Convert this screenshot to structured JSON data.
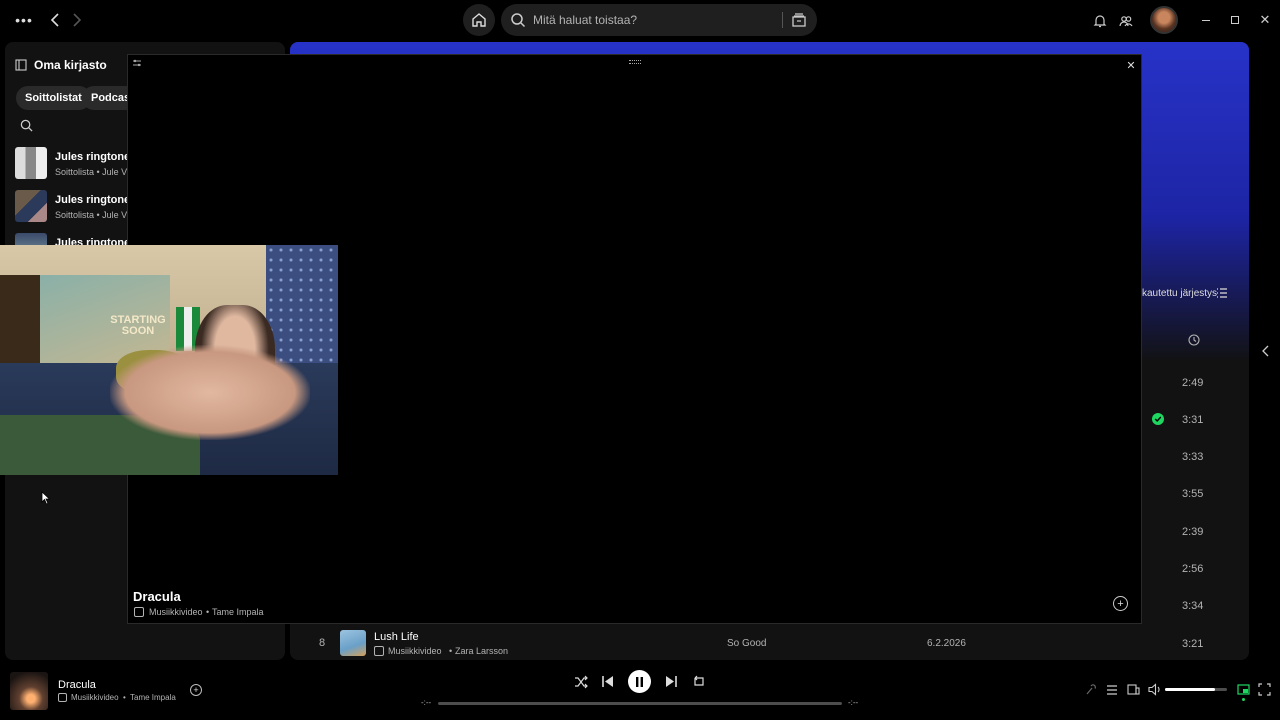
{
  "topbar": {
    "search_placeholder": "Mitä haluat toistaa?"
  },
  "library": {
    "title": "Oma kirjasto",
    "filters": [
      "Soittolistat",
      "Podcastit"
    ],
    "items": [
      {
        "title": "Jules ringtones",
        "subtitle": "Soittolista • Jule V"
      },
      {
        "title": "Jules ringtones",
        "subtitle": "Soittolista • Jule V"
      },
      {
        "title": "Jules ringtones",
        "subtitle": ""
      }
    ]
  },
  "main": {
    "sort_label": "kautettu järjestys",
    "durations": [
      "2:49",
      "3:31",
      "3:33",
      "3:55",
      "2:39",
      "2:56",
      "3:34"
    ],
    "row8": {
      "number": "8",
      "title": "Lush Life",
      "type": "Musiikkivideo",
      "artist": "Zara Larsson",
      "album": "So Good",
      "date": "6.2.2026",
      "duration": "3:21"
    }
  },
  "video_overlay": {
    "title": "Dracula",
    "type": "Musiikkivideo",
    "artist": "Tame Impala"
  },
  "webcam": {
    "poster_text": "STARTING SOON"
  },
  "player": {
    "title": "Dracula",
    "type": "Musiikkivideo",
    "artist": "Tame Impala",
    "elapsed": "-:--",
    "remaining": "-:--",
    "volume": 0.8
  },
  "colors": {
    "accent": "#1ed760",
    "header_blue": "#2733c8"
  }
}
